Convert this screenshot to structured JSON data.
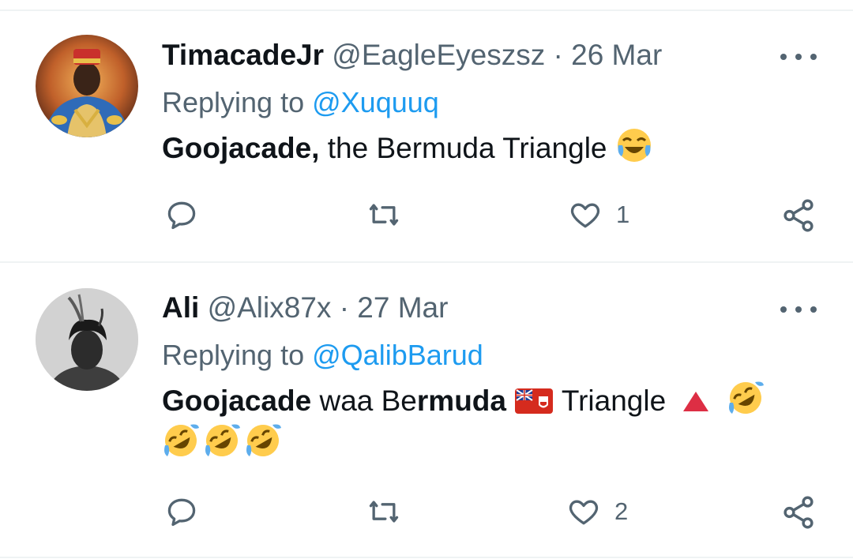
{
  "tweets": [
    {
      "name": "TimacadeJr",
      "handle": "@EagleEyeszsz",
      "separator": "·",
      "date": "26 Mar",
      "replying_prefix": "Replying to",
      "replying_to": "@Xuquuq",
      "body_bold": "Goojacade,",
      "body_text": " the Bermuda Triangle",
      "emojis": [
        "face-with-tears-of-joy"
      ],
      "reply_count": "",
      "retweet_count": "",
      "like_count": "1"
    },
    {
      "name": "Ali",
      "handle": "@Alix87x",
      "separator": "·",
      "date": "27 Mar",
      "replying_prefix": "Replying to",
      "replying_to": "@QalibBarud",
      "body_bold": "Goojacade",
      "body_text_1": " waa Be",
      "body_bold_2": "rmuda",
      "body_text_2": "Triangle",
      "emojis": [
        "bermuda-flag",
        "red-triangle",
        "rolling-on-floor-laughing",
        "rolling-on-floor-laughing",
        "rolling-on-floor-laughing",
        "rolling-on-floor-laughing"
      ],
      "reply_count": "",
      "retweet_count": "",
      "like_count": "2"
    }
  ],
  "colors": {
    "text": "#0f1419",
    "secondary": "#536471",
    "accent": "#1d9bf0",
    "divider": "#eff3f4"
  },
  "icons": [
    "reply-icon",
    "retweet-icon",
    "like-icon",
    "share-icon",
    "more-icon"
  ]
}
